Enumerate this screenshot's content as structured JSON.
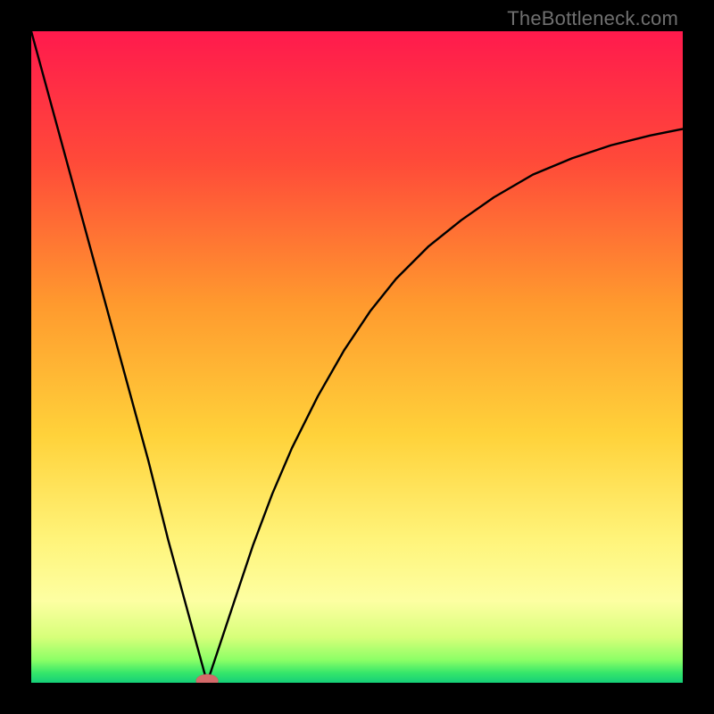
{
  "watermark": "TheBottleneck.com",
  "colors": {
    "frame": "#000000",
    "curve": "#000000",
    "marker_fill": "#d46a6a",
    "marker_stroke": "#c05a5a",
    "gradient_stops": [
      {
        "offset": 0.0,
        "color": "#ff1a4d"
      },
      {
        "offset": 0.2,
        "color": "#ff4a39"
      },
      {
        "offset": 0.42,
        "color": "#ff9a2e"
      },
      {
        "offset": 0.62,
        "color": "#ffd23a"
      },
      {
        "offset": 0.78,
        "color": "#fff47a"
      },
      {
        "offset": 0.875,
        "color": "#fdffa2"
      },
      {
        "offset": 0.93,
        "color": "#d7ff7a"
      },
      {
        "offset": 0.965,
        "color": "#8cff66"
      },
      {
        "offset": 0.985,
        "color": "#35e66a"
      },
      {
        "offset": 1.0,
        "color": "#14cf78"
      }
    ]
  },
  "chart_data": {
    "type": "line",
    "title": "",
    "xlabel": "",
    "ylabel": "",
    "xlim": [
      0,
      100
    ],
    "ylim": [
      0,
      100
    ],
    "notch": {
      "x": 27,
      "y": 0
    },
    "curve_points": [
      {
        "x": 0,
        "y": 100
      },
      {
        "x": 3,
        "y": 89
      },
      {
        "x": 6,
        "y": 78
      },
      {
        "x": 9,
        "y": 67
      },
      {
        "x": 12,
        "y": 56
      },
      {
        "x": 15,
        "y": 45
      },
      {
        "x": 18,
        "y": 34
      },
      {
        "x": 21,
        "y": 22
      },
      {
        "x": 24,
        "y": 11
      },
      {
        "x": 27,
        "y": 0
      },
      {
        "x": 29,
        "y": 6
      },
      {
        "x": 31,
        "y": 12
      },
      {
        "x": 34,
        "y": 21
      },
      {
        "x": 37,
        "y": 29
      },
      {
        "x": 40,
        "y": 36
      },
      {
        "x": 44,
        "y": 44
      },
      {
        "x": 48,
        "y": 51
      },
      {
        "x": 52,
        "y": 57
      },
      {
        "x": 56,
        "y": 62
      },
      {
        "x": 61,
        "y": 67
      },
      {
        "x": 66,
        "y": 71
      },
      {
        "x": 71,
        "y": 74.5
      },
      {
        "x": 77,
        "y": 78
      },
      {
        "x": 83,
        "y": 80.5
      },
      {
        "x": 89,
        "y": 82.5
      },
      {
        "x": 95,
        "y": 84
      },
      {
        "x": 100,
        "y": 85
      }
    ],
    "marker": {
      "x": 27,
      "y": 0.3,
      "rx": 1.7,
      "ry": 1.0
    }
  }
}
